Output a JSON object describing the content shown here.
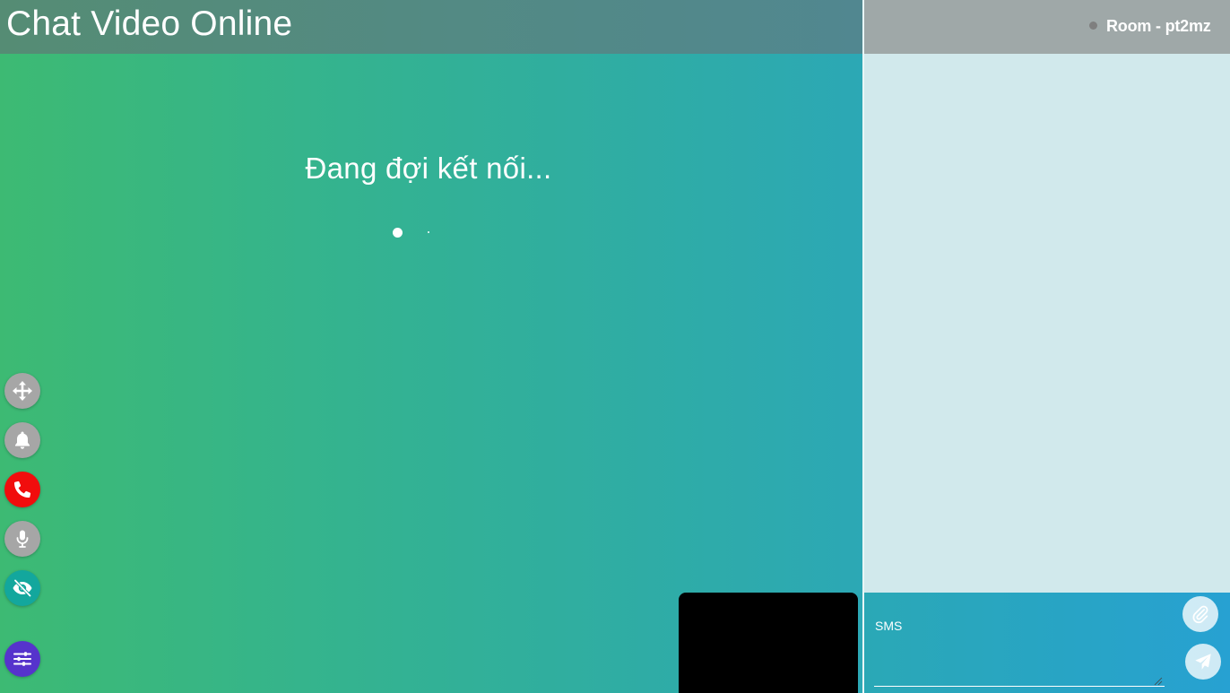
{
  "header": {
    "title": "Chat Video Online"
  },
  "call": {
    "status": "Đang đợi kết nối..."
  },
  "controls": [
    {
      "name": "move-button",
      "icon": "move-arrows-icon",
      "color": "#a6a6a6"
    },
    {
      "name": "notification-button",
      "icon": "bell-icon",
      "color": "#a6a6a6"
    },
    {
      "name": "end-call-button",
      "icon": "phone-icon",
      "color": "#f10d0d"
    },
    {
      "name": "microphone-button",
      "icon": "microphone-icon",
      "color": "#a6a6a6"
    },
    {
      "name": "hide-video-button",
      "icon": "eye-slash-icon",
      "color": "#13a79d"
    },
    {
      "name": "settings-button",
      "icon": "sliders-icon",
      "color": "#5633cc"
    }
  ],
  "room": {
    "label": "Room - pt2mz",
    "status_color": "#7f7f7f"
  },
  "chat": {
    "placeholder": "SMS",
    "attach_icon": "paperclip-icon",
    "send_icon": "paper-plane-icon"
  }
}
